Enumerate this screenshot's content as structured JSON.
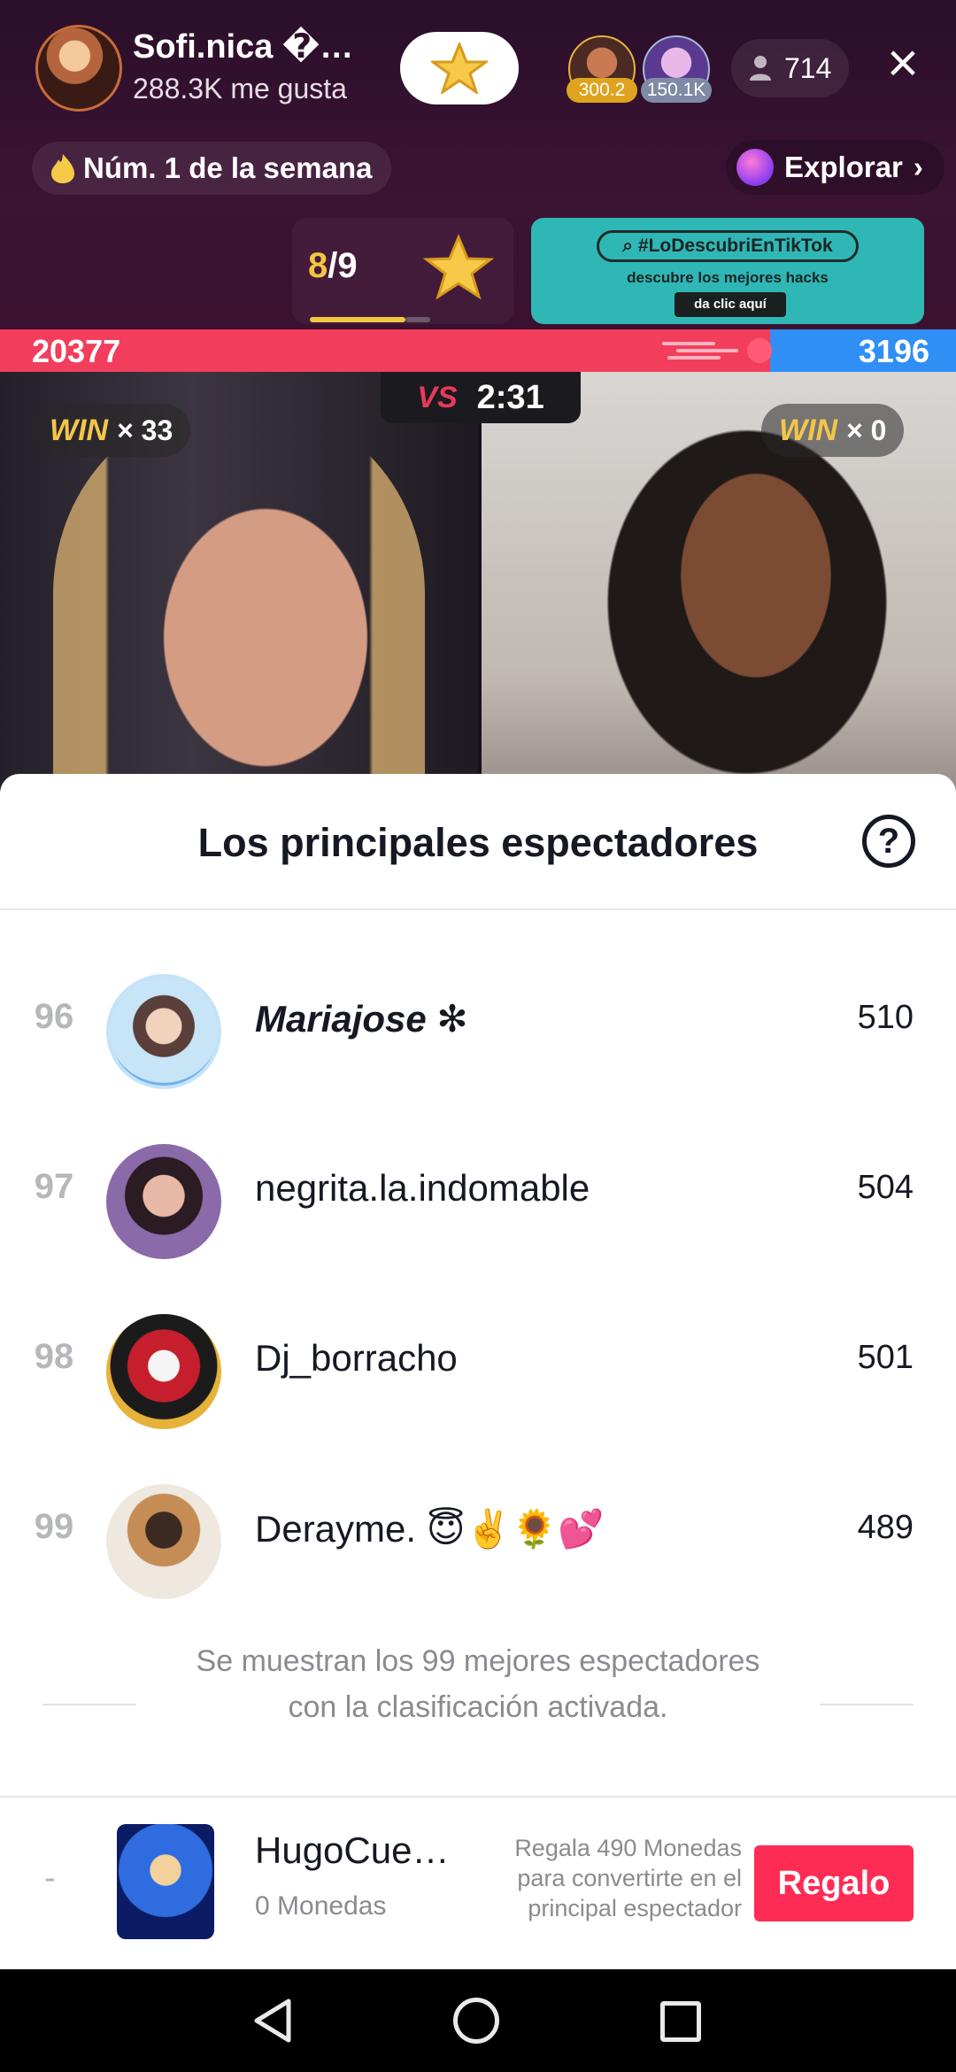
{
  "live": {
    "host_name": "Sofi.nica �…",
    "host_likes": "288.3K me gusta",
    "top_viewers": [
      {
        "badge": "300.2"
      },
      {
        "badge": "150.1K"
      }
    ],
    "viewer_count": "714",
    "rank_badge": "Núm. 1 de la semana",
    "explore_label": "Explorar",
    "page_current": "8",
    "page_total": "/9",
    "promo": {
      "hashtag": "#LoDescubriEnTikTok",
      "subtitle": "descubre los mejores hacks",
      "cta": "da clic aquí"
    }
  },
  "battle": {
    "score_left": "20377",
    "score_right": "3196",
    "vs_label": "VS",
    "timer": "2:31",
    "win_word": "WIN",
    "win_left": "× 33",
    "win_right": "× 0",
    "colors": {
      "left": "#f23e5c",
      "right": "#2f8ff5"
    }
  },
  "sheet": {
    "title": "Los principales espectadores",
    "help_glyph": "?",
    "rows": [
      {
        "rank": "96",
        "name": "Mariajose ✻",
        "coins": "510"
      },
      {
        "rank": "97",
        "name": "negrita.la.indomable",
        "coins": "504"
      },
      {
        "rank": "98",
        "name": "Dj_borracho",
        "coins": "501"
      },
      {
        "rank": "99",
        "name": "Derayme. 😇✌️🌻💕",
        "coins": "489"
      }
    ],
    "footnote": "Se muestran los 99 mejores espectadores con la clasificación activada.",
    "me": {
      "rank": "-",
      "name": "HugoCue…",
      "coins": "0 Monedas",
      "hint": "Regala 490 Monedas para convertirte en el principal espectador",
      "gift_label": "Regalo"
    },
    "accent": "#fe2c55"
  }
}
